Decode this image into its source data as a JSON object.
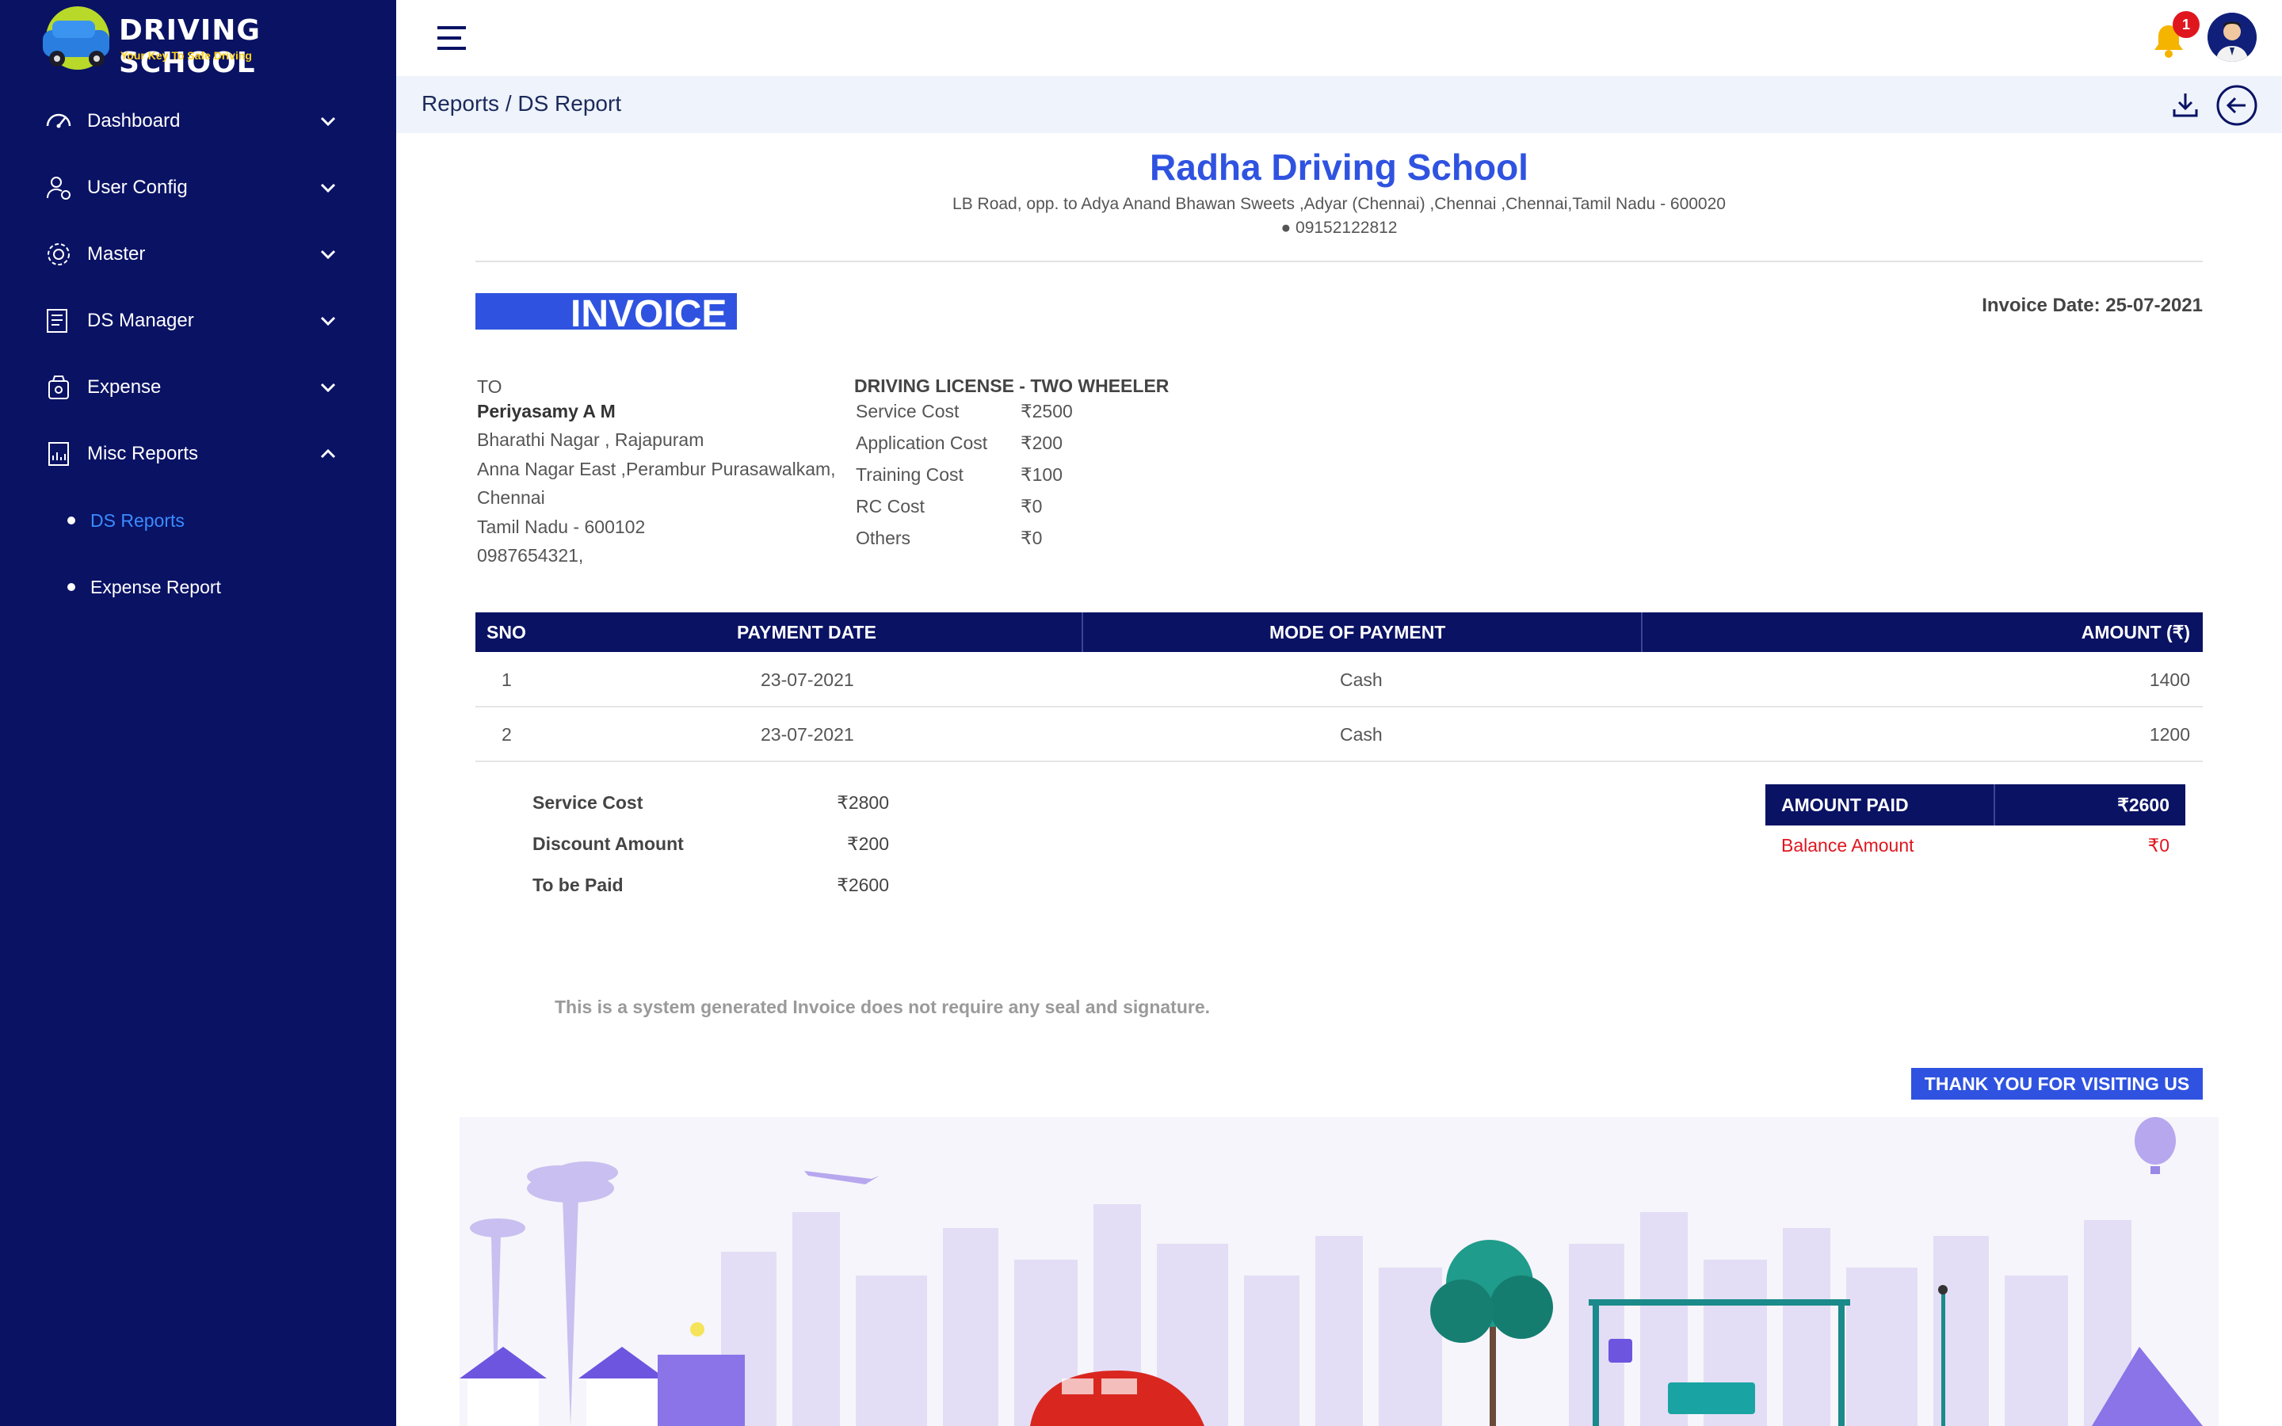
{
  "brand": {
    "name": "DRIVING SCHOOL",
    "tagline": "Your Key To Safe Driving"
  },
  "sidebar": {
    "items": [
      {
        "label": "Dashboard",
        "icon": "gauge-icon"
      },
      {
        "label": "User Config",
        "icon": "user-gear-icon"
      },
      {
        "label": "Master",
        "icon": "gear-icon"
      },
      {
        "label": "DS Manager",
        "icon": "ledger-icon"
      },
      {
        "label": "Expense",
        "icon": "wallet-icon"
      },
      {
        "label": "Misc Reports",
        "icon": "report-icon"
      }
    ],
    "sub_items": [
      {
        "label": "DS Reports",
        "active": true
      },
      {
        "label": "Expense Report",
        "active": false
      }
    ]
  },
  "header": {
    "notification_count": "1"
  },
  "breadcrumb": "Reports / DS Report",
  "school": {
    "name": "Radha Driving School",
    "address": "LB Road, opp. to Adya Anand Bhawan Sweets ,Adyar (Chennai) ,Chennai ,Chennai,Tamil Nadu - 600020",
    "phone": "● 09152122812"
  },
  "invoice": {
    "title": "INVOICE",
    "date_label": "Invoice Date: 25-07-2021",
    "to": {
      "label": "TO",
      "name": "Periyasamy A M",
      "line1": "Bharathi Nagar , Rajapuram",
      "line2": "Anna Nagar East ,Perambur Purasawalkam,",
      "line3": "Chennai",
      "line4": "Tamil Nadu - 600102",
      "line5": "0987654321,"
    },
    "license": {
      "title": "DRIVING LICENSE - TWO WHEELER",
      "rows": [
        {
          "label": "Service Cost",
          "value": "₹2500"
        },
        {
          "label": "Application Cost",
          "value": "₹200"
        },
        {
          "label": "Training Cost",
          "value": "₹100"
        },
        {
          "label": "RC Cost",
          "value": "₹0"
        },
        {
          "label": "Others",
          "value": "₹0"
        }
      ]
    },
    "payments": {
      "headers": {
        "sno": "SNO",
        "date": "PAYMENT DATE",
        "mode": "MODE OF PAYMENT",
        "amount": "AMOUNT (₹)"
      },
      "rows": [
        {
          "sno": "1",
          "date": "23-07-2021",
          "mode": "Cash",
          "amount": "1400"
        },
        {
          "sno": "2",
          "date": "23-07-2021",
          "mode": "Cash",
          "amount": "1200"
        }
      ]
    },
    "summary": [
      {
        "label": "Service Cost",
        "value": "₹2800"
      },
      {
        "label": "Discount Amount",
        "value": "₹200"
      },
      {
        "label": "To be Paid",
        "value": "₹2600"
      }
    ],
    "amount_paid": {
      "label": "AMOUNT PAID",
      "value": "₹2600"
    },
    "balance": {
      "label": "Balance Amount",
      "value": "₹0"
    },
    "note": "This is a system generated Invoice does not require any seal and signature.",
    "thanks": "THANK YOU FOR VISITING US"
  }
}
